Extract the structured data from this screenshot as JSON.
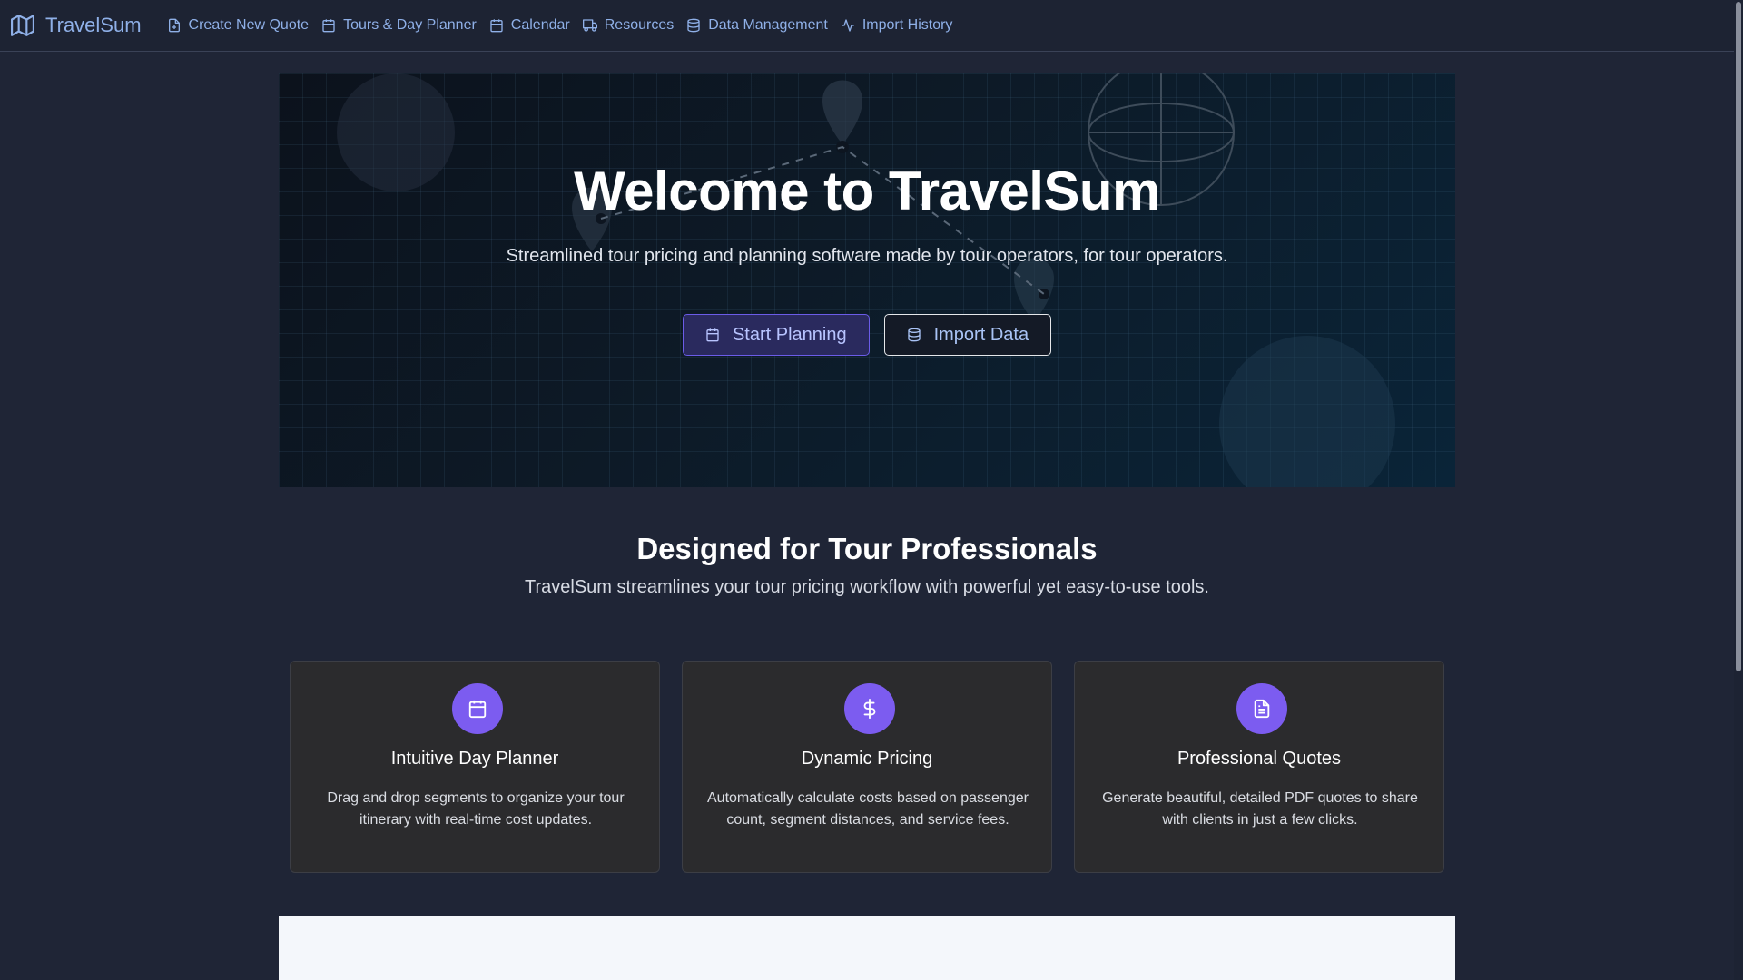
{
  "app": {
    "name": "TravelSum",
    "accent_color": "#7c5cf0",
    "link_color": "#8fb0e8"
  },
  "nav": {
    "brand": {
      "label": "TravelSum",
      "icon": "map-icon"
    },
    "items": [
      {
        "label": "Create New Quote",
        "icon": "file-plus-icon"
      },
      {
        "label": "Tours & Day Planner",
        "icon": "calendar-icon"
      },
      {
        "label": "Calendar",
        "icon": "calendar-icon"
      },
      {
        "label": "Resources",
        "icon": "truck-icon"
      },
      {
        "label": "Data Management",
        "icon": "database-icon"
      },
      {
        "label": "Import History",
        "icon": "activity-icon"
      }
    ]
  },
  "hero": {
    "title": "Welcome to TravelSum",
    "subtitle": "Streamlined tour pricing and planning software made by tour operators, for tour operators.",
    "primary_button": {
      "label": "Start Planning",
      "icon": "calendar-icon"
    },
    "secondary_button": {
      "label": "Import Data",
      "icon": "database-icon"
    }
  },
  "features": {
    "title": "Designed for Tour Professionals",
    "subtitle": "TravelSum streamlines your tour pricing workflow with powerful yet easy-to-use tools.",
    "cards": [
      {
        "title": "Intuitive Day Planner",
        "description": "Drag and drop segments to organize your tour itinerary with real-time cost updates.",
        "icon": "calendar-icon"
      },
      {
        "title": "Dynamic Pricing",
        "description": "Automatically calculate costs based on passenger count, segment distances, and service fees.",
        "icon": "dollar-icon"
      },
      {
        "title": "Professional Quotes",
        "description": "Generate beautiful, detailed PDF quotes to share with clients in just a few clicks.",
        "icon": "file-text-icon"
      }
    ]
  }
}
